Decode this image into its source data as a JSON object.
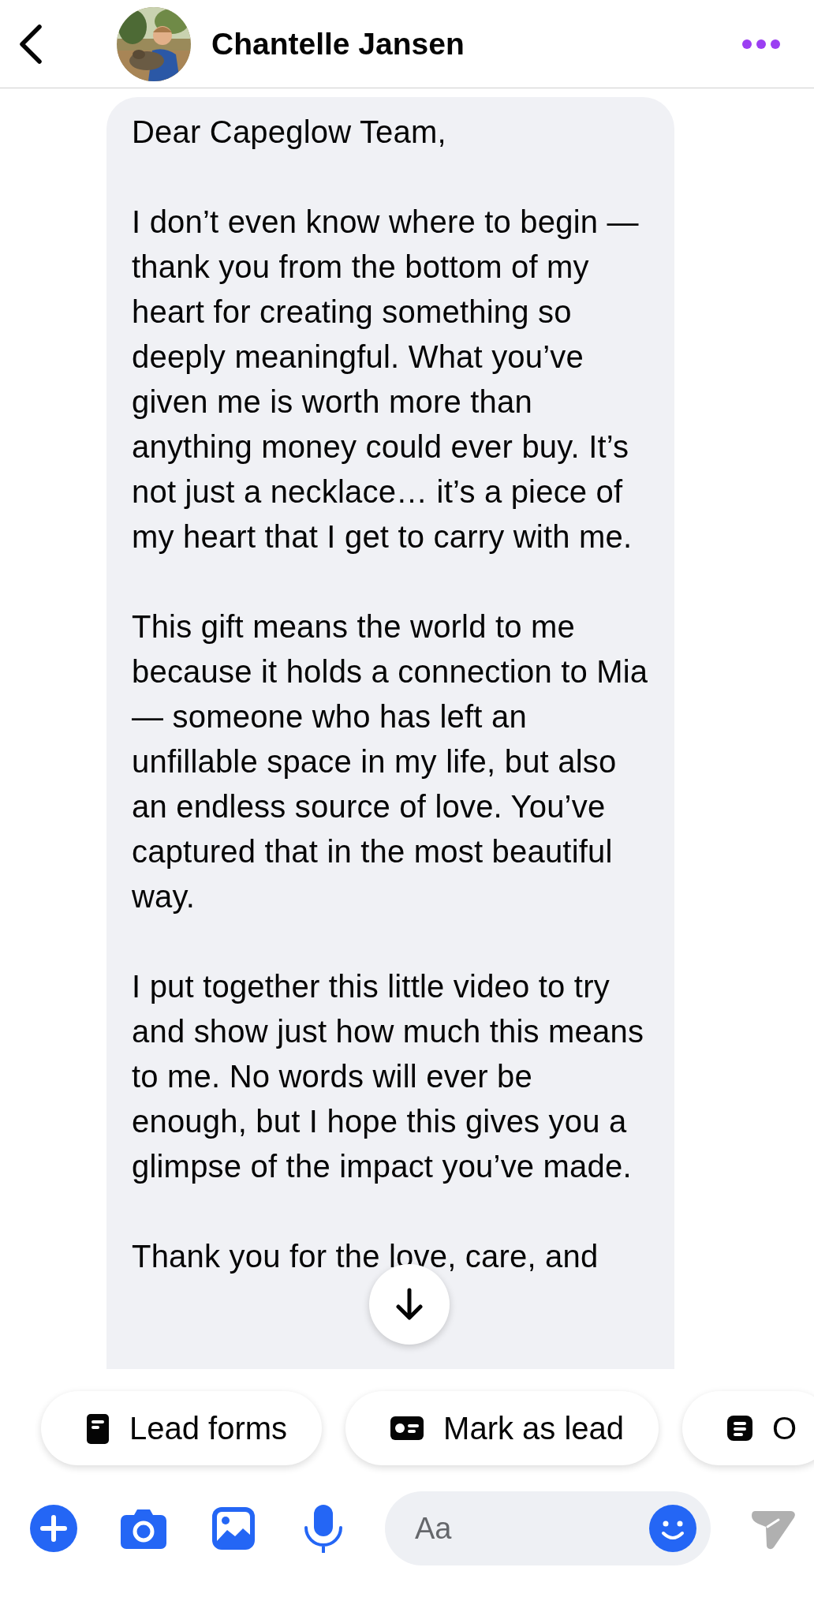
{
  "header": {
    "contact_name": "Chantelle Jansen"
  },
  "message": {
    "paragraphs": [
      "Dear Capeglow Team,",
      "I don’t even know where to begin — thank you from the bottom of my heart for creating something so deeply meaningful. What you’ve given me is worth more than anything money could ever buy. It’s not just a necklace… it’s a piece of my heart that I get to carry with me.",
      "This gift means the world to me because it holds a connection to Mia — someone who has left an unfillable space in my life, but also an endless source of love. You’ve captured that in the most beautiful way.",
      "I put together this little video to try and show just how much this means to me. No words will ever be enough, but I hope this gives you a glimpse of the impact you’ve made.",
      "Thank you for the love, care, and"
    ]
  },
  "quick_actions": [
    {
      "kind": "form",
      "label": "Lead forms"
    },
    {
      "kind": "card",
      "label": "Mark as lead"
    },
    {
      "kind": "list",
      "label": "O"
    }
  ],
  "composer": {
    "placeholder": "Aa"
  }
}
